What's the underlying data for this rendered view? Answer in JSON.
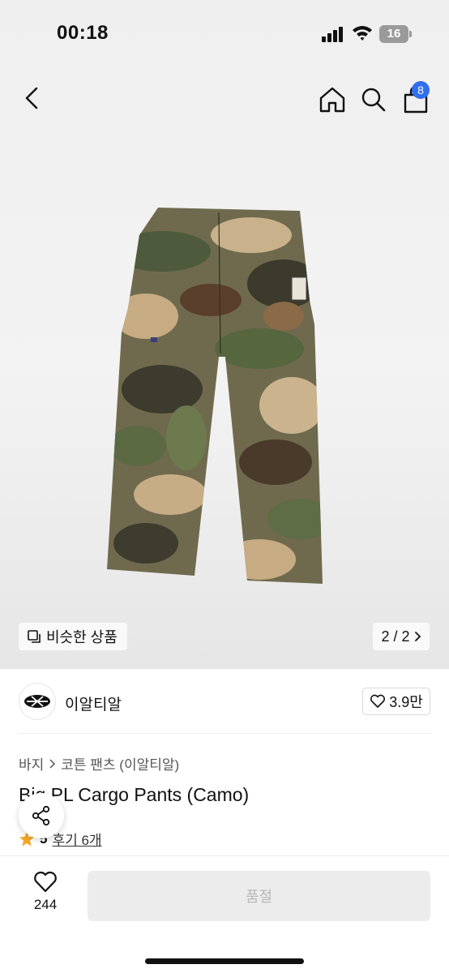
{
  "status_bar": {
    "time": "00:18",
    "battery": "16"
  },
  "nav": {
    "cart_count": "8",
    "icons": [
      "chevron-left-icon",
      "home-icon",
      "search-icon",
      "shopping-bag-icon"
    ]
  },
  "gallery": {
    "similar_label": "비슷한 상품",
    "page": "2 / 2"
  },
  "brand": {
    "name": "이알티알",
    "likes": "3.9만"
  },
  "breadcrumb": {
    "category": "바지",
    "subcategory": "코튼 팬츠 (이알티알)"
  },
  "product": {
    "title": "Big PL Cargo Pants (Camo)"
  },
  "rating": {
    "value": "5",
    "reviews": "후기 6개"
  },
  "bottom": {
    "wish_count": "244",
    "buy_label": "품절"
  },
  "colors": {
    "accent": "#2f6ff0",
    "star": "#f5a623",
    "disabled_bg": "#ececec",
    "disabled_text": "#b8b8b8"
  }
}
